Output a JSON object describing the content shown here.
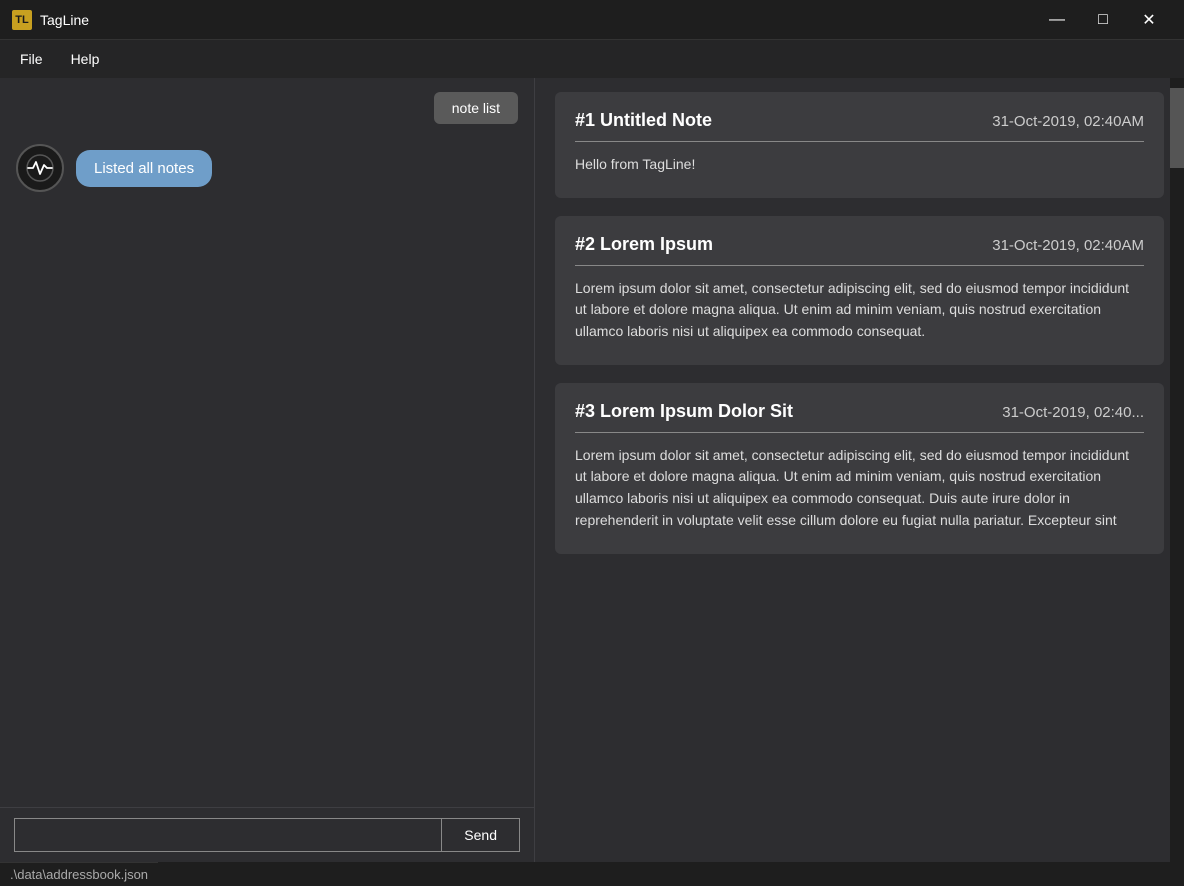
{
  "titlebar": {
    "icon": "🏷",
    "title": "TagLine",
    "minimize": "—",
    "maximize": "□",
    "close": "✕"
  },
  "menubar": {
    "items": [
      {
        "label": "File"
      },
      {
        "label": "Help"
      }
    ]
  },
  "left": {
    "note_list_btn": "note list",
    "chat_avatar_icon": "pulse",
    "chat_bubble": "Listed all notes",
    "input_placeholder": "",
    "send_label": "Send"
  },
  "notes": [
    {
      "id": "#1",
      "title": "Untitled Note",
      "date": "31-Oct-2019, 02:40AM",
      "body": "Hello from TagLine!"
    },
    {
      "id": "#2",
      "title": "Lorem Ipsum",
      "date": "31-Oct-2019, 02:40AM",
      "body": "Lorem ipsum dolor sit amet, consectetur adipiscing elit, sed do eiusmod tempor incididunt ut labore et dolore magna aliqua. Ut enim ad minim veniam, quis nostrud exercitation ullamco laboris nisi ut aliquipex ea commodo consequat."
    },
    {
      "id": "#3",
      "title": "Lorem Ipsum Dolor Sit",
      "date": "31-Oct-2019, 02:40...",
      "body": "Lorem ipsum dolor sit amet, consectetur adipiscing elit, sed do eiusmod tempor incididunt ut labore et dolore magna aliqua. Ut enim ad minim veniam, quis nostrud exercitation ullamco laboris nisi ut aliquipex ea commodo consequat. Duis aute irure dolor in reprehenderit in voluptate velit esse cillum dolore eu fugiat nulla pariatur. Excepteur sint"
    }
  ],
  "statusbar": {
    "path": ".\\data\\addressbook.json"
  }
}
